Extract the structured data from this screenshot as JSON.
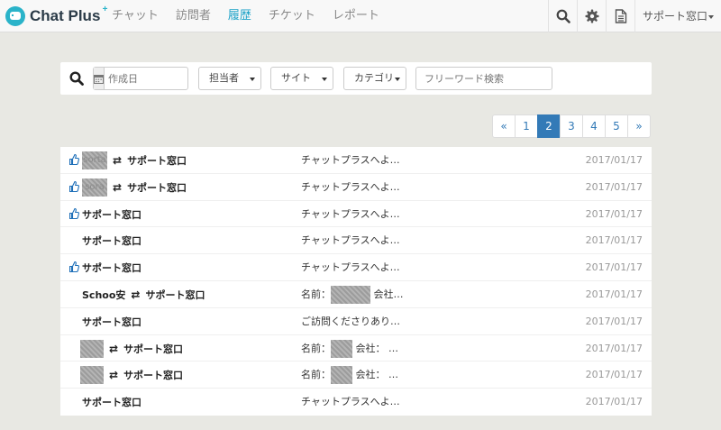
{
  "app": {
    "name": "Chat Plus",
    "name_sup": "+"
  },
  "nav": {
    "items": [
      {
        "label": "チャット"
      },
      {
        "label": "訪問者"
      },
      {
        "label": "履歴",
        "active": true
      },
      {
        "label": "チケット"
      },
      {
        "label": "レポート"
      }
    ]
  },
  "header": {
    "icons": [
      "search-icon",
      "gear-icon",
      "document-icon"
    ],
    "user_label": "サポート窓口"
  },
  "filter": {
    "icon": "search-icon",
    "date_icon": "calendar-icon",
    "date_placeholder": "作成日",
    "selects": {
      "assignee": "担当者",
      "site": "サイト",
      "category": "カテゴリ"
    },
    "keyword_placeholder": "フリーワード検索"
  },
  "pagination": {
    "prev": "«",
    "pages": [
      "1",
      "2",
      "3",
      "4",
      "5"
    ],
    "current": "2",
    "next": "»"
  },
  "colors": {
    "accent": "#1aa1c7",
    "brand": "#2ab3c9",
    "pager_active": "#337ab7",
    "background": "#e8e8e3"
  },
  "rows": [
    {
      "liked": true,
      "visitor": "sorta",
      "operator": "サポート窓口",
      "message": "チャットプラスへよ…",
      "date": "2017/01/17"
    },
    {
      "liked": true,
      "visitor": "sora",
      "operator": "サポート窓口",
      "message": "チャットプラスへよ…",
      "date": "2017/01/17"
    },
    {
      "liked": true,
      "operator": "サポート窓口",
      "message": "チャットプラスへよ…",
      "date": "2017/01/17"
    },
    {
      "liked": false,
      "operator": "サポート窓口",
      "message": "チャットプラスへよ…",
      "date": "2017/01/17"
    },
    {
      "liked": true,
      "operator": "サポート窓口",
      "message": "チャットプラスへよ…",
      "date": "2017/01/17"
    },
    {
      "liked": false,
      "visitor": "Schoo安",
      "operator": "サポート窓口",
      "message_a": "名前：",
      "message_b": "会社…",
      "date": "2017/01/17"
    },
    {
      "liked": false,
      "operator": "サポート窓口",
      "message": "ご訪問くださりあり…",
      "date": "2017/01/17"
    },
    {
      "liked": false,
      "operator": "サポート窓口",
      "message_a": "名前：",
      "message_b": "会社： …",
      "date": "2017/01/17"
    },
    {
      "liked": false,
      "operator": "サポート窓口",
      "message_a": "名前：",
      "message_b": "会社： …",
      "date": "2017/01/17"
    },
    {
      "liked": false,
      "operator": "サポート窓口",
      "message": "チャットプラスへよ…",
      "date": "2017/01/17"
    }
  ]
}
